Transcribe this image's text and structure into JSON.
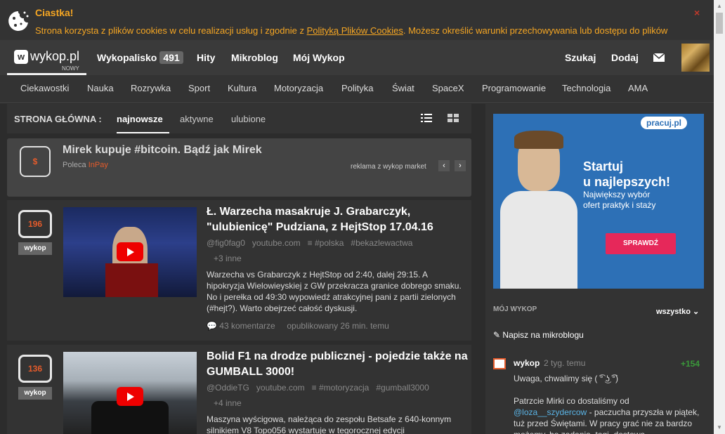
{
  "cookie": {
    "title": "Ciastka!",
    "text_before": "Strona korzysta z plików cookies w celu realizacji usług i zgodnie z",
    "link": "Polityką Plików Cookies",
    "text_after": ". Możesz określić warunki przechowywania lub dostępu do plików",
    "close": "×"
  },
  "header": {
    "logo_text": "wykop.pl",
    "logo_sub": "NOWY",
    "nav": [
      {
        "label": "Wykopalisko",
        "badge": "491"
      },
      {
        "label": "Hity"
      },
      {
        "label": "Mikroblog"
      },
      {
        "label": "Mój Wykop"
      }
    ],
    "search_label": "Szukaj",
    "add_label": "Dodaj"
  },
  "categories": [
    "Ciekawostki",
    "Nauka",
    "Rozrywka",
    "Sport",
    "Kultura",
    "Motoryzacja",
    "Polityka",
    "Świat",
    "SpaceX",
    "Programowanie",
    "Technologia",
    "AMA"
  ],
  "subbar": {
    "label": "STRONA GŁÓWNA :",
    "tabs": [
      "najnowsze",
      "aktywne",
      "ulubione"
    ]
  },
  "ad": {
    "icon": "$",
    "title": "Mirek kupuje #bitcoin. Bądź jak Mirek",
    "poleca": "Poleca",
    "sponsor": "InPay",
    "market": "reklama z wykop market"
  },
  "items": [
    {
      "votes": "196",
      "vote_label": "wykop",
      "title": "Ł. Warzecha masakruje J. Grabarczyk, \"ulubienicę\" Pudziana, z HejtStop 17.04.16",
      "author": "@fig0fag0",
      "source": "youtube.com",
      "tags": [
        "#polska",
        "#bekazlewactwa"
      ],
      "more_tags": "+3 inne",
      "description": "Warzecha vs Grabarczyk z HejtStop od 2:40, dalej 29:15. A hipokryzja Wielowieyskiej z GW przekracza granice dobrego smaku. No i perełka od 49:30 wypowiedź atrakcyjnej pani z partii zielonych (#hejt?). Warto obejrzeć całość dyskusji.",
      "comments": "43 komentarze",
      "published": "opublikowany 26 min. temu"
    },
    {
      "votes": "136",
      "vote_label": "wykop",
      "title": "Bolid F1 na drodze publicznej - pojedzie także na GUMBALL 3000!",
      "author": "@OddieTG",
      "source": "youtube.com",
      "tags": [
        "#motoryzacja",
        "#gumball3000"
      ],
      "more_tags": "+4 inne",
      "description": "Maszyna wyścigowa, należąca do zespołu Betsafe z 640-konnym silnikiem V8 Topo056 wystartuje w tegorocznej edycji",
      "comments": "",
      "published": ""
    }
  ],
  "sidebar": {
    "banner": {
      "logo": "pracuj.pl",
      "headline_1": "Startuj",
      "headline_2": "u najlepszych!",
      "sub_1": "Największy wybór",
      "sub_2": "ofert praktyk i staży",
      "button": "SPRAWDŹ"
    },
    "moj_wykop": "MÓJ WYKOP",
    "filter": "wszystko",
    "write": "Napisz na mikroblogu",
    "entry": {
      "author": "wykop",
      "time": "2 tyg. temu",
      "points": "+154",
      "line1": "Uwaga, chwalimy się ( ͡° ͜ʖ ͡°)",
      "line2": "Patrzcie Mirki co dostaliśmy od",
      "mention": "@loza__szydercow",
      "line3": " - paczucha przyszła w piątek, tuż przed Świętami. W pracy grać nie za bardzo możemy, bo zadania, tagi, dostawa"
    }
  }
}
